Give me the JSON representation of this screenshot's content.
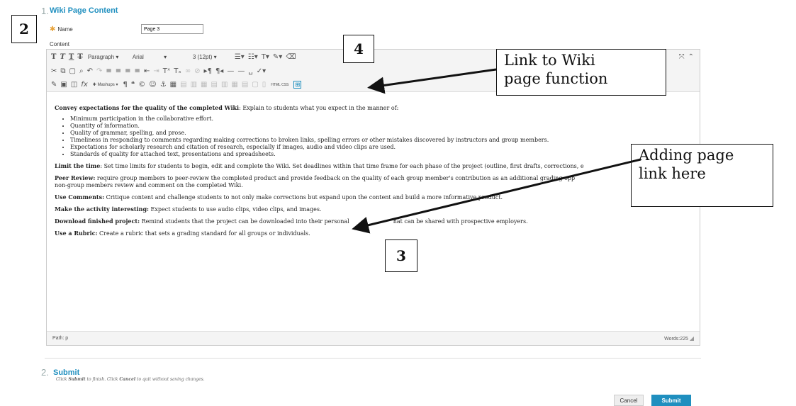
{
  "section1": {
    "number": "1.",
    "title": "Wiki Page Content"
  },
  "name_field": {
    "label": "Name",
    "value": "Page 3"
  },
  "content_label": "Content",
  "toolbar": {
    "format_select": "Paragraph",
    "font_select": "Arial",
    "size_select": "3 (12pt)",
    "mashups_label": "Mashups",
    "html_label": "HTML CSS"
  },
  "body": {
    "p1_bold": "Convey expectations for the quality of the completed Wiki",
    "p1_rest": ": Explain to students what you expect in the manner of:",
    "bullets": [
      "Minimum participation in the collaborative effort.",
      "Quantity of information.",
      "Quality of grammar, spelling, and prose.",
      "Timeliness in responding to comments regarding making corrections to broken links, spelling errors or other mistakes discovered by instructors and group members.",
      "Expectations for scholarly research and citation of research, especially if images, audio and video clips are used.",
      "Standards of quality for attached text, presentations and spreadsheets."
    ],
    "p2_bold": "Limit the time",
    "p2_rest": ": Set time limits for students to begin, edit and complete the Wiki. Set deadlines within that time frame for each phase of the project (outline, first drafts, corrections, e",
    "p3_bold": "Peer Review:",
    "p3_rest": " require group members to peer-review the completed product and provide feedback on the quality of each group member's contribution as an additional grading opp",
    "p3_line2": "non-group members review and comment on the completed Wiki.",
    "p4_bold": "Use Comments:",
    "p4_rest": " Critique content and challenge students to not only make corrections but expand upon the content and build a more informative product.",
    "p5_bold": "Make the activity interesting:",
    "p5_rest": " Expect students to use audio clips, video clips, and images.",
    "p6_bold": "Download finished project:",
    "p6_rest": " Remind students that the project can be downloaded into their personal",
    "p6_tail": "hat can be shared with prospective employers.",
    "p7_bold": "Use a Rubric:",
    "p7_rest": " Create a rubric that sets a grading standard for all groups or individuals."
  },
  "status": {
    "path": "Path: p",
    "words": "Words:225"
  },
  "section2": {
    "number": "2.",
    "title": "Submit",
    "hint_pre": "Click ",
    "hint_submit": "Submit",
    "hint_mid": " to finish. Click ",
    "hint_cancel": "Cancel",
    "hint_post": " to quit without saving changes."
  },
  "buttons": {
    "cancel": "Cancel",
    "submit": "Submit"
  },
  "callouts": {
    "n2": "2",
    "n3": "3",
    "n4": "4",
    "link_line1": "Link to Wiki",
    "link_line2": "page function",
    "add_line1": "Adding page",
    "add_line2": "link here"
  }
}
